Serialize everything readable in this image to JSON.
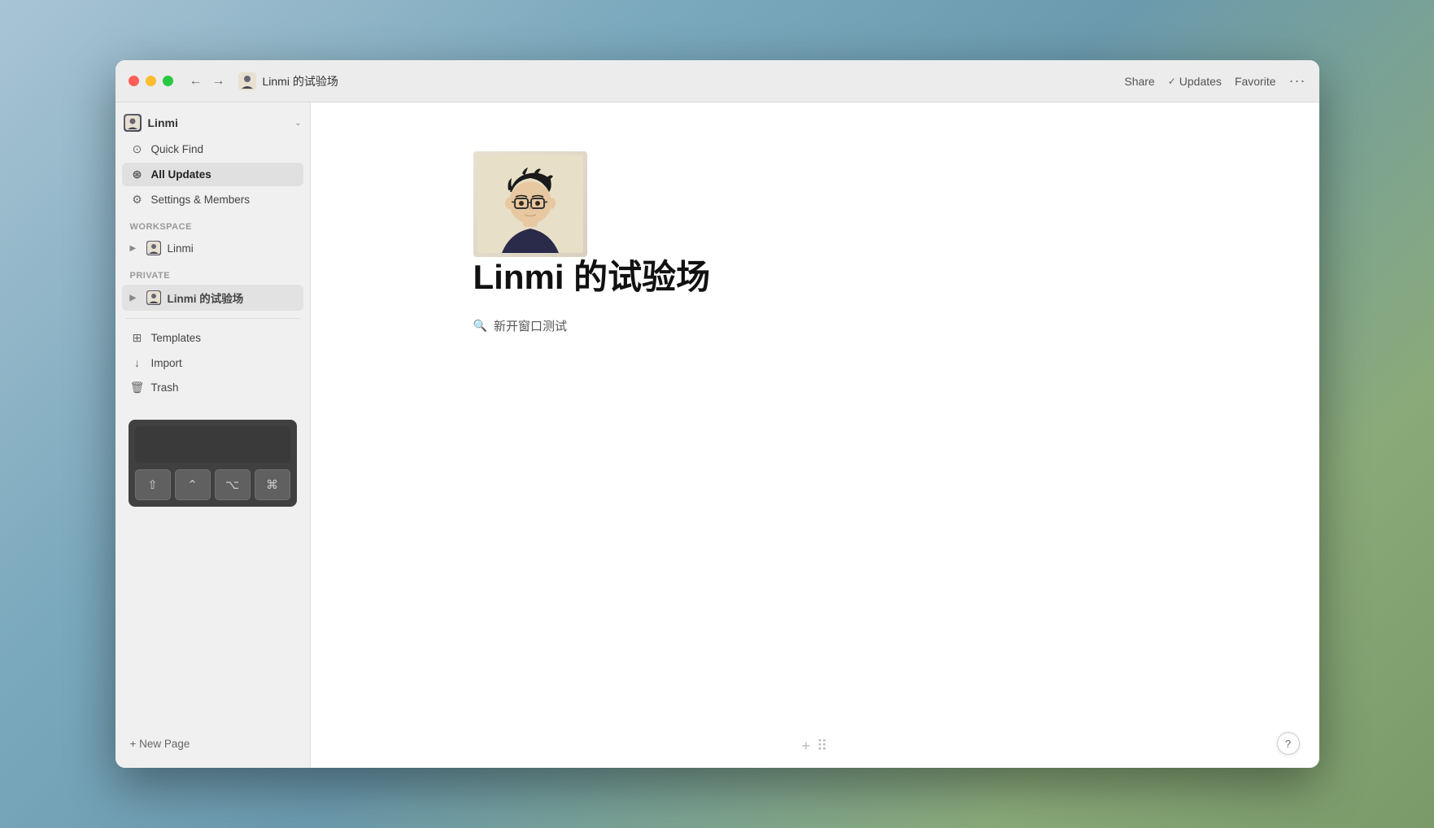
{
  "window": {
    "title": "Linmi 的试验场"
  },
  "titlebar": {
    "back_label": "←",
    "forward_label": "→",
    "page_title": "Linmi 的试验场",
    "share_label": "Share",
    "updates_label": "Updates",
    "favorite_label": "Favorite",
    "more_label": "···"
  },
  "sidebar": {
    "user": {
      "name": "Linmi",
      "dropdown_icon": "⌄"
    },
    "nav_items": [
      {
        "id": "quick-find",
        "icon": "⊙",
        "label": "Quick Find"
      },
      {
        "id": "all-updates",
        "icon": "⊛",
        "label": "All Updates",
        "active": true
      },
      {
        "id": "settings",
        "icon": "⚙",
        "label": "Settings & Members"
      }
    ],
    "workspace_section": "WORKSPACE",
    "workspace_items": [
      {
        "id": "linmi-workspace",
        "label": "Linmi"
      }
    ],
    "private_section": "PRIVATE",
    "private_items": [
      {
        "id": "linmi-test",
        "label": "Linmi 的试验场",
        "active": true
      }
    ],
    "bottom_items": [
      {
        "id": "templates",
        "icon": "⊞",
        "label": "Templates"
      },
      {
        "id": "import",
        "icon": "↓",
        "label": "Import"
      },
      {
        "id": "trash",
        "icon": "🗑",
        "label": "Trash"
      }
    ],
    "new_page_label": "+ New Page"
  },
  "keyboard_widget": {
    "keys": [
      "⇧",
      "⌃",
      "⌥",
      "⌘"
    ]
  },
  "page": {
    "title": "Linmi 的试验场",
    "sub_item": {
      "icon": "🔍",
      "label": "新开窗口测试"
    }
  },
  "bottom_bar": {
    "add_icon": "+",
    "grid_icon": "⠿"
  },
  "help_btn": "?"
}
